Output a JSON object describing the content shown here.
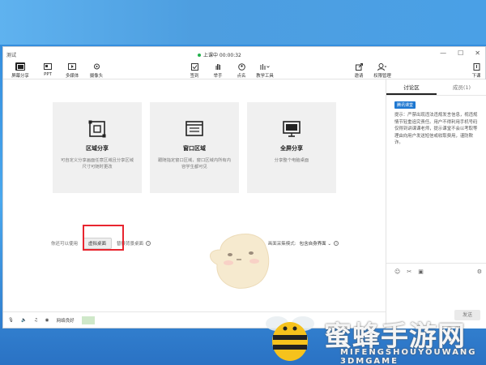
{
  "window": {
    "title": "测试"
  },
  "session": {
    "status": "上课中 00:00:32"
  },
  "controls": {
    "min": "—",
    "max": "☐",
    "close": "✕"
  },
  "toolbar": {
    "left": [
      {
        "label": "屏幕分享",
        "icon": "screen-share-icon"
      },
      {
        "label": "PPT",
        "icon": "ppt-icon"
      },
      {
        "label": "多媒体",
        "icon": "media-icon"
      },
      {
        "label": "摄像头",
        "icon": "camera-icon"
      }
    ],
    "center": [
      {
        "label": "签到",
        "icon": "checkin-icon"
      },
      {
        "label": "举手",
        "icon": "hand-icon"
      },
      {
        "label": "点名",
        "icon": "rollcall-icon"
      },
      {
        "label": "教学工具",
        "icon": "tools-icon"
      }
    ],
    "right": [
      {
        "label": "邀请",
        "icon": "invite-icon"
      },
      {
        "label": "权限管理",
        "icon": "permission-icon"
      },
      {
        "label": "下课",
        "icon": "exit-icon"
      }
    ]
  },
  "cards": [
    {
      "title": "区域分享",
      "desc": "可自定义分享画面任意区域且分享区域尺寸可随时更改",
      "icon": "region-share-icon"
    },
    {
      "title": "窗口区域",
      "desc": "跟随指定窗口区域，窗口区域内所有内容学生都可见",
      "icon": "window-share-icon"
    },
    {
      "title": "全屏分享",
      "desc": "分享整个电脑桌面",
      "icon": "fullscreen-share-icon"
    }
  ],
  "options": {
    "prefix": "你还可以使用",
    "virtual_desktop": "虚拟桌面",
    "replace_bg": "替换背景桌面",
    "mode_label": "画面采集模式:",
    "mode_value": "包含自身界面"
  },
  "statusbar": {
    "network": "网络良好"
  },
  "sidebar": {
    "tabs": [
      "讨论区",
      "成员(1)"
    ],
    "badge": "腾讯课堂",
    "notice": "提示：严禁出现违法违规发言信息，视违规情节轻重追究责任。用户不得利用手机号码仅得到讲课课老师，提示课堂不会以考取等理由向用户发送短信或收取费用，谨防欺诈。",
    "send": "发送"
  },
  "watermark": {
    "cn": "蜜蜂手游网",
    "en": "MIFENGSHOUYOUWANG  3DMGAME"
  },
  "colors": {
    "accent": "#1f78d1",
    "highlight": "#e8252f",
    "card_bg": "#f0f0f0"
  }
}
